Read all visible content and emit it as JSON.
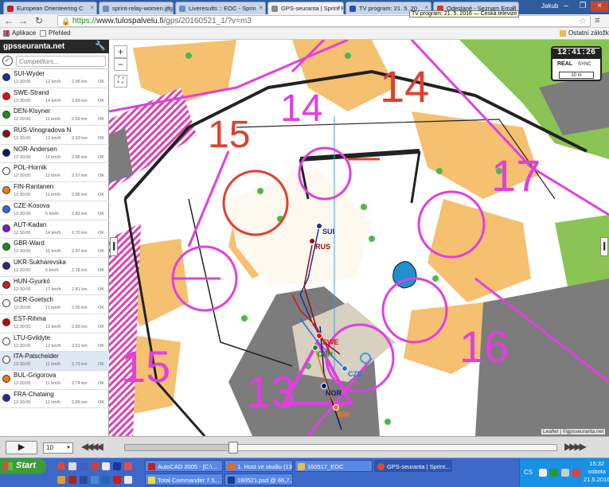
{
  "browser": {
    "tabs": [
      {
        "label": "European Orienteering C",
        "color": "#c81e1e"
      },
      {
        "label": "sprint-relay-women.jpg (",
        "color": "#6b8ec8"
      },
      {
        "label": "Liveresults :: EOC - Sprin",
        "color": "#6b8ec8"
      },
      {
        "label": "GPS-seuranta | Sprint Re",
        "color": "#888888"
      },
      {
        "label": "TV program: 21. 5. 20",
        "color": "#2050c0"
      },
      {
        "label": "Odeslané - Seznam Email",
        "color": "#d04020"
      }
    ],
    "user": "Jakub",
    "tooltip": "TV program: 21. 5. 2016 — Česká televize",
    "url_scheme": "https://",
    "url_host": "www.tulospalvelu.fi",
    "url_path": "/gps/20160521_1/?v=m3",
    "bookmarks": {
      "apps": "Aplikace",
      "overview": "Přehled",
      "other": "Ostatní záložky"
    }
  },
  "app": {
    "brand": "gpsseuranta.net",
    "search_placeholder": "Competitors...",
    "competitors": [
      {
        "name": "SUI-Wyder",
        "time": "12:30:00",
        "speed": "12 km/h",
        "dist": "2.96 km",
        "status": "OK",
        "color": "#1a2ea0"
      },
      {
        "name": "SWE-Strand",
        "time": "12:30:00",
        "speed": "14 km/h",
        "dist": "2.89 km",
        "status": "OK",
        "color": "#e01010"
      },
      {
        "name": "DEN-Klsyner",
        "time": "12:30:00",
        "speed": "11 km/h",
        "dist": "2.69 km",
        "status": "OK",
        "color": "#189018"
      },
      {
        "name": "RUS-Vinogradova N",
        "time": "12:30:00",
        "speed": "13 km/h",
        "dist": "2.93 km",
        "status": "OK",
        "color": "#8b0e0e"
      },
      {
        "name": "NOR-Andersen",
        "time": "12:30:00",
        "speed": "11 km/h",
        "dist": "2.85 km",
        "status": "OK",
        "color": "#0a1a6a"
      },
      {
        "name": "POL-Hornik",
        "time": "12:30:00",
        "speed": "11 km/h",
        "dist": "2.67 km",
        "status": "OK",
        "color": "#ffffff"
      },
      {
        "name": "FIN-Rantanen",
        "time": "12:30:00",
        "speed": "11 km/h",
        "dist": "2.85 km",
        "status": "OK",
        "color": "#f07818"
      },
      {
        "name": "CZE-Kosova",
        "time": "12:30:00",
        "speed": "5 km/h",
        "dist": "2.83 km",
        "status": "OK",
        "color": "#2d6ed8"
      },
      {
        "name": "AUT-Kadan",
        "time": "12:30:00",
        "speed": "14 km/h",
        "dist": "2.70 km",
        "status": "OK",
        "color": "#7a1ad0"
      },
      {
        "name": "GBR-Ward",
        "time": "12:30:00",
        "speed": "15 km/h",
        "dist": "2.97 km",
        "status": "OK",
        "color": "#1a8a1a"
      },
      {
        "name": "UKR-Sukharevska",
        "time": "12:30:00",
        "speed": "5 km/h",
        "dist": "2.78 km",
        "status": "OK",
        "color": "#3a2080"
      },
      {
        "name": "HUN-Gyurkó",
        "time": "12:30:00",
        "speed": "17 km/h",
        "dist": "2.81 km",
        "status": "OK",
        "color": "#d01818"
      },
      {
        "name": "GER-Goetsch",
        "time": "12:30:00",
        "speed": "11 km/h",
        "dist": "2.60 km",
        "status": "OK",
        "color": "#ffffff"
      },
      {
        "name": "EST-Rihma",
        "time": "12:30:00",
        "speed": "13 km/h",
        "dist": "2.83 km",
        "status": "OK",
        "color": "#b80c0c"
      },
      {
        "name": "LTU-Gvildyte",
        "time": "12:30:00",
        "speed": "12 km/h",
        "dist": "2.61 km",
        "status": "OK",
        "color": "#ffffff"
      },
      {
        "name": "ITA-Patscheider",
        "time": "12:30:00",
        "speed": "11 km/h",
        "dist": "2.73 km",
        "status": "OK",
        "color": "#ffffff"
      },
      {
        "name": "BUL-Grigorova",
        "time": "12:30:00",
        "speed": "11 km/h",
        "dist": "2.74 km",
        "status": "OK",
        "color": "#f07818"
      },
      {
        "name": "FRA-Chataing",
        "time": "12:30:00",
        "speed": "11 km/h",
        "dist": "2.85 km",
        "status": "OK",
        "color": "#1a2ea0"
      }
    ],
    "selected_index": 15,
    "map": {
      "zoom_in": "+",
      "zoom_out": "−",
      "clock_time": "12:41:26",
      "mode": "REAL",
      "sync": "SYNC",
      "scale": "10 m",
      "attribution": "Leaflet | ©gpsseuranta.net",
      "control_numbers": [
        "14",
        "14",
        "15",
        "15",
        "13",
        "16",
        "17"
      ],
      "runner_labels": [
        "SUI",
        "RUS",
        "SWE",
        "DEN",
        "CZE",
        "NOR",
        "FIN"
      ]
    },
    "playback": {
      "play": "▶",
      "speed": "10",
      "progress": 0.25
    }
  },
  "taskbar": {
    "start": "Start",
    "windows_top": [
      "AutoCAD 2005 - [C:\\...",
      "1. Host ve studiu (13...",
      "160517_EOC",
      "GPS-seuranta | Sprint..."
    ],
    "windows_bottom": [
      "Total Commander 7.5...",
      "160521.psd @ 66,7..."
    ],
    "lang": "CS",
    "time": "15:32",
    "day": "sobota",
    "date": "21.5.2016"
  }
}
